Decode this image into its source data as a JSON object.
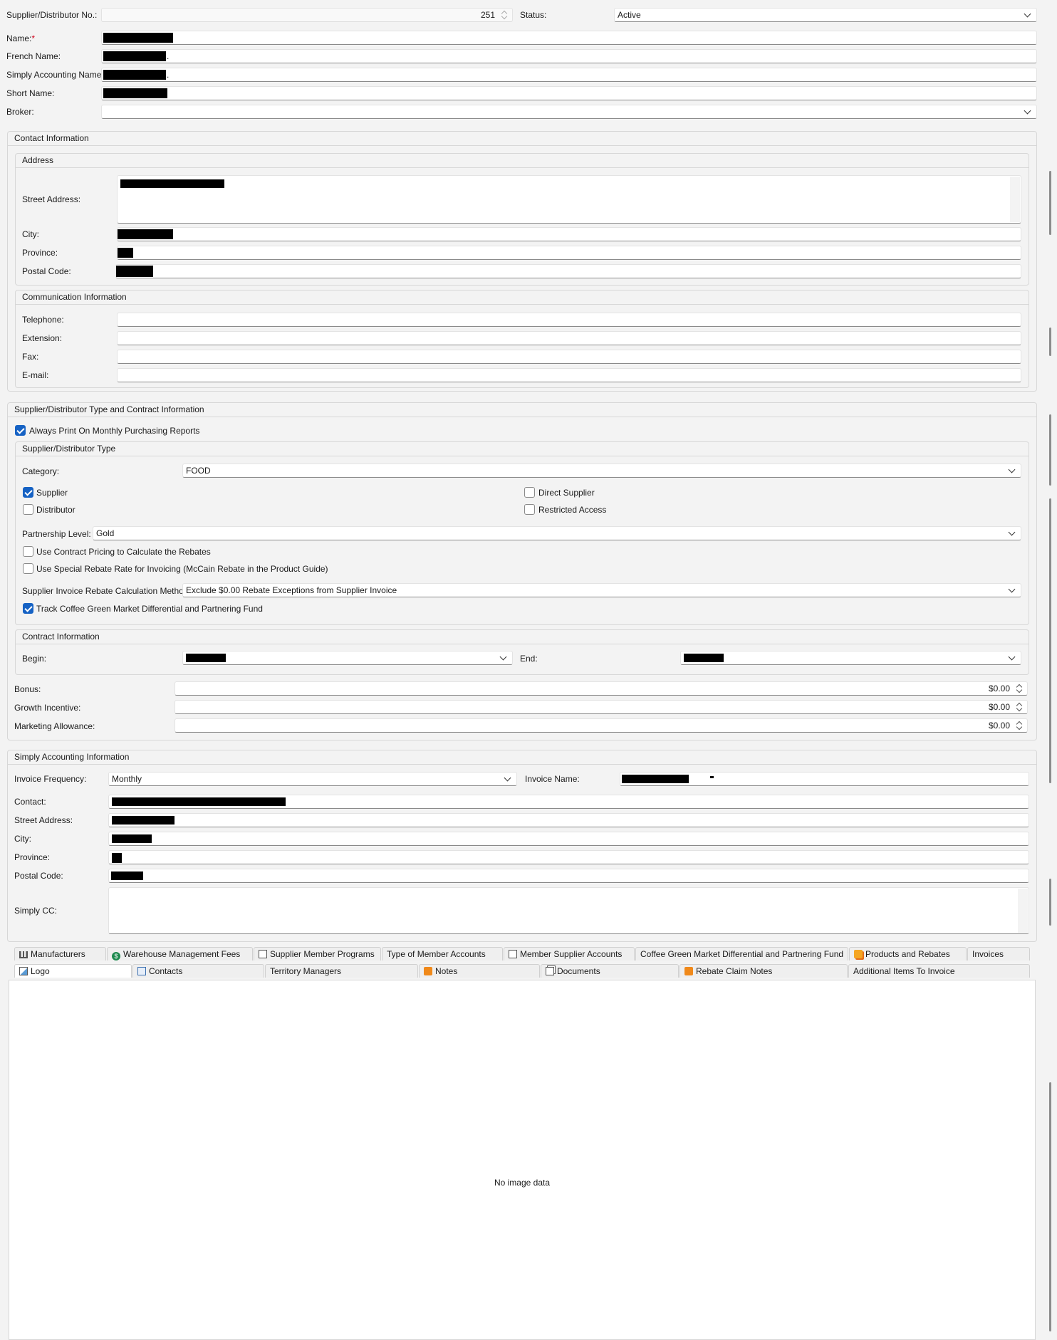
{
  "header": {
    "supplier_no_label": "Supplier/Distributor No.:",
    "supplier_no_value": "251",
    "status_label": "Status:",
    "status_value": "Active",
    "name_label": "Name:",
    "name_required": "*",
    "french_name_label": "French Name:",
    "french_name_suffix": ".",
    "simply_name_label": "Simply Accounting Name:",
    "simply_name_suffix": ".",
    "short_name_label": "Short Name:",
    "broker_label": "Broker:"
  },
  "contact": {
    "title": "Contact Information",
    "address_title": "Address",
    "street_label": "Street Address:",
    "city_label": "City:",
    "province_label": "Province:",
    "postal_label": "Postal Code:",
    "comm_title": "Communication Information",
    "telephone_label": "Telephone:",
    "extension_label": "Extension:",
    "fax_label": "Fax:",
    "email_label": "E-mail:"
  },
  "type_section": {
    "title": "Supplier/Distributor Type and Contract Information",
    "always_print_label": "Always Print On Monthly Purchasing Reports",
    "always_print_checked": true,
    "type_title": "Supplier/Distributor Type",
    "category_label": "Category:",
    "category_value": "FOOD",
    "supplier_label": "Supplier",
    "supplier_checked": true,
    "distributor_label": "Distributor",
    "distributor_checked": false,
    "direct_supplier_label": "Direct Supplier",
    "direct_supplier_checked": false,
    "restricted_access_label": "Restricted Access",
    "restricted_access_checked": false,
    "partnership_label": "Partnership Level:",
    "partnership_value": "Gold",
    "use_contract_label": "Use Contract Pricing to Calculate the Rebates",
    "use_contract_checked": false,
    "use_special_label": "Use Special Rebate Rate for Invoicing (McCain Rebate in the Product Guide)",
    "use_special_checked": false,
    "calc_method_label": "Supplier Invoice Rebate Calculation Method:",
    "calc_method_value": "Exclude $0.00 Rebate Exceptions from Supplier Invoice",
    "track_coffee_label": "Track Coffee Green Market Differential and Partnering Fund",
    "track_coffee_checked": true,
    "contract_title": "Contract Information",
    "begin_label": "Begin:",
    "end_label": "End:",
    "bonus_label": "Bonus:",
    "bonus_value": "$0.00",
    "growth_label": "Growth Incentive:",
    "growth_value": "$0.00",
    "marketing_label": "Marketing Allowance:",
    "marketing_value": "$0.00"
  },
  "simply": {
    "title": "Simply Accounting Information",
    "invoice_freq_label": "Invoice Frequency:",
    "invoice_freq_value": "Monthly",
    "invoice_name_label": "Invoice Name:",
    "contact_label": "Contact:",
    "street_label": "Street Address:",
    "city_label": "City:",
    "province_label": "Province:",
    "postal_label": "Postal Code:",
    "simply_cc_label": "Simply CC:"
  },
  "tabs_row1": [
    {
      "label": "Manufacturers",
      "icon": "factory-icon"
    },
    {
      "label": "Warehouse Management Fees",
      "icon": "dollar-icon"
    },
    {
      "label": "Supplier Member Programs",
      "icon": "document-icon"
    },
    {
      "label": "Type of Member Accounts",
      "icon": ""
    },
    {
      "label": "Member Supplier Accounts",
      "icon": "document-icon"
    },
    {
      "label": "Coffee Green Market Differential and Partnering Fund",
      "icon": ""
    },
    {
      "label": "Products and Rebates",
      "icon": "stack-icon"
    },
    {
      "label": "Invoices",
      "icon": ""
    }
  ],
  "tabs_row2": [
    {
      "label": "Logo",
      "icon": "image-icon"
    },
    {
      "label": "Contacts",
      "icon": "contact-card-icon"
    },
    {
      "label": "Territory Managers",
      "icon": ""
    },
    {
      "label": "Notes",
      "icon": "note-icon"
    },
    {
      "label": "Documents",
      "icon": "documents-icon"
    },
    {
      "label": "Rebate Claim Notes",
      "icon": "note-icon"
    },
    {
      "label": "Additional Items To Invoice",
      "icon": ""
    }
  ],
  "logo_panel": {
    "empty_text": "No image data"
  },
  "colors": {
    "accent": "#1662c4",
    "background": "#f3f3f3",
    "field_bg": "#ffffff"
  }
}
